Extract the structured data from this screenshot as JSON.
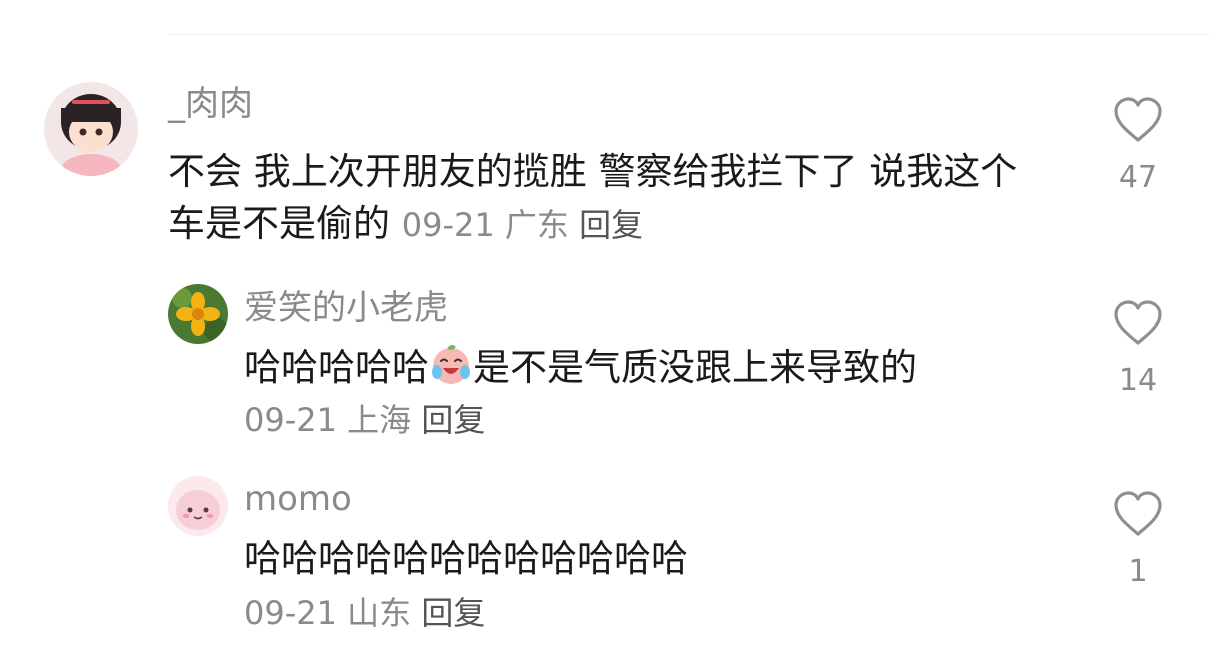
{
  "comments": [
    {
      "username": "_肉肉",
      "text": "不会 我上次开朋友的揽胜 警察给我拦下了 说我这个车是不是偷的",
      "date": "09-21",
      "location": "广东",
      "reply_label": "回复",
      "likes": "47"
    },
    {
      "username": "爱笑的小老虎",
      "text_before_emoji": "哈哈哈哈哈",
      "emoji": "laughing-crying-emoji",
      "text_after_emoji": "是不是气质没跟上来导致的",
      "date": "09-21",
      "location": "上海",
      "reply_label": "回复",
      "likes": "14"
    },
    {
      "username": "momo",
      "text": "哈哈哈哈哈哈哈哈哈哈哈哈",
      "date": "09-21",
      "location": "山东",
      "reply_label": "回复",
      "likes": "1"
    }
  ],
  "icons": {
    "like": "heart-outline-icon"
  }
}
